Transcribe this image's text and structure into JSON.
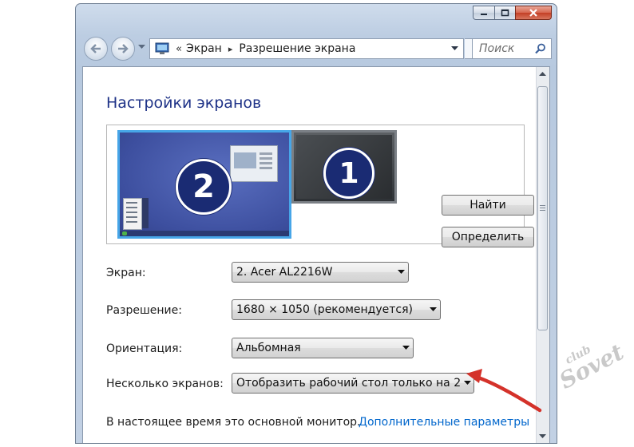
{
  "breadcrumb": {
    "root_chevron": "«",
    "part1": "Экран",
    "separator": "▸",
    "part2": "Разрешение экрана"
  },
  "search": {
    "placeholder": "Поиск"
  },
  "page": {
    "title": "Настройки экранов"
  },
  "preview": {
    "monitor_2_number": "2",
    "monitor_1_number": "1",
    "selected_monitor": "2"
  },
  "buttons": {
    "find": "Найти",
    "identify": "Определить"
  },
  "settings": {
    "screen_label": "Экран:",
    "screen_value": "2. Acer AL2216W",
    "resolution_label": "Разрешение:",
    "resolution_value": "1680 × 1050 (рекомендуется)",
    "orientation_label": "Ориентация:",
    "orientation_value": "Альбомная",
    "multiple_label": "Несколько экранов:",
    "multiple_value": "Отобразить рабочий стол только на 2"
  },
  "status_text": "В настоящее время это основной монитор.",
  "advanced_link": "Дополнительные параметры",
  "watermark": {
    "small": "club",
    "big": "Sovet"
  },
  "colors": {
    "title": "#1e3287",
    "link": "#0066cc",
    "selected_monitor_border": "#47a6e8",
    "annotation_arrow": "#d4322a"
  },
  "icons": {
    "back": "back-arrow-icon",
    "forward": "forward-arrow-icon",
    "address": "display-control-panel-icon",
    "refresh": "refresh-icon",
    "search": "magnifier-icon",
    "close": "close-icon"
  }
}
